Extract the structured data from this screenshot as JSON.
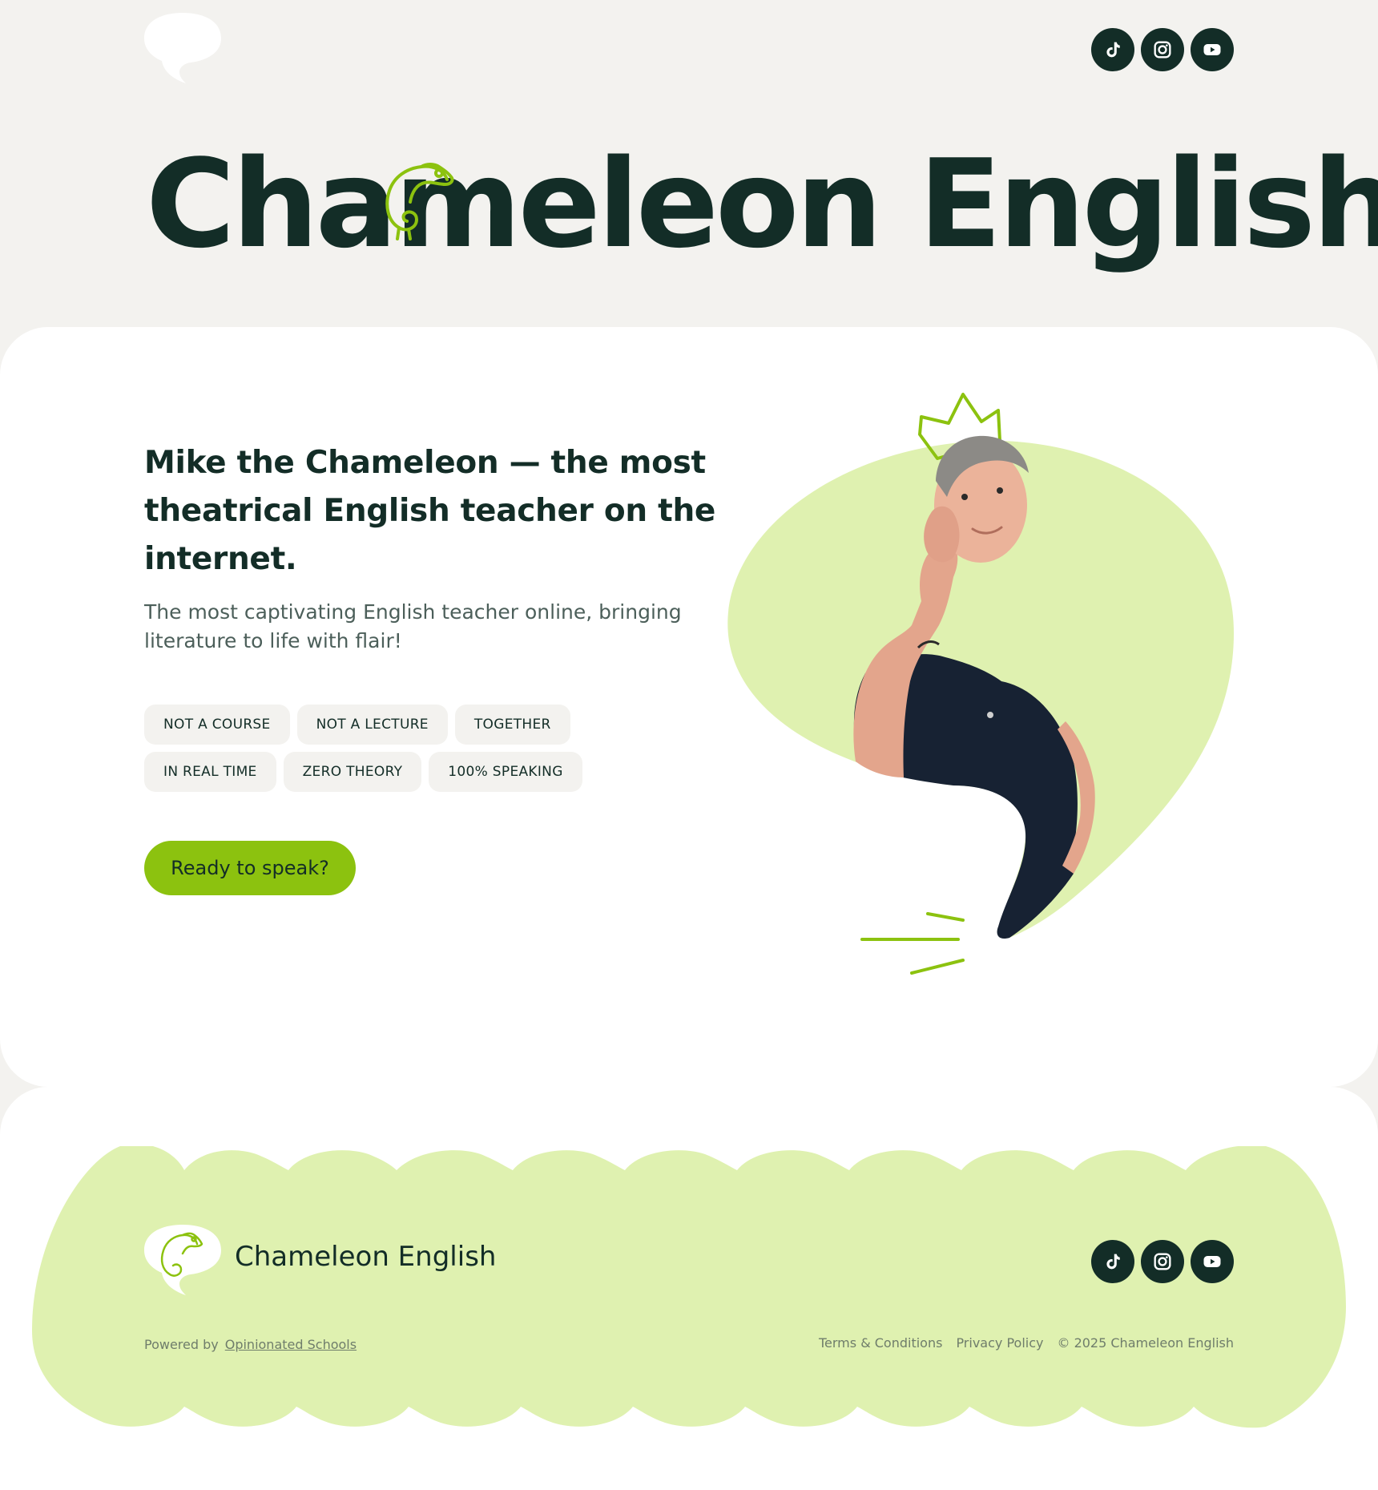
{
  "header": {
    "logo": "speech-bubble-logo",
    "socials": [
      {
        "name": "tiktok",
        "icon": "tiktok-icon"
      },
      {
        "name": "instagram",
        "icon": "instagram-icon"
      },
      {
        "name": "youtube",
        "icon": "youtube-icon"
      }
    ]
  },
  "hero": {
    "brand_title": "Chameleon English",
    "headline": "Mike the Chameleon — the most theatrical English teacher on the internet.",
    "subheadline": "The most captivating English teacher online, bringing literature to life with flair!",
    "tags": [
      "NOT A COURSE",
      "NOT A LECTURE",
      "TOGETHER",
      "IN REAL TIME",
      "ZERO THEORY",
      "100% SPEAKING"
    ],
    "cta_label": "Ready to speak?"
  },
  "footer": {
    "brand_name": "Chameleon English",
    "powered_by_label": "Powered by",
    "powered_by_link": "Opinionated Schools",
    "links": [
      "Terms & Conditions",
      "Privacy Policy"
    ],
    "copyright": "© 2025 Chameleon English"
  },
  "colors": {
    "dark": "#132d27",
    "accent": "#8cc20f",
    "light_green": "#dff1b0",
    "background": "#f3f2ef"
  }
}
